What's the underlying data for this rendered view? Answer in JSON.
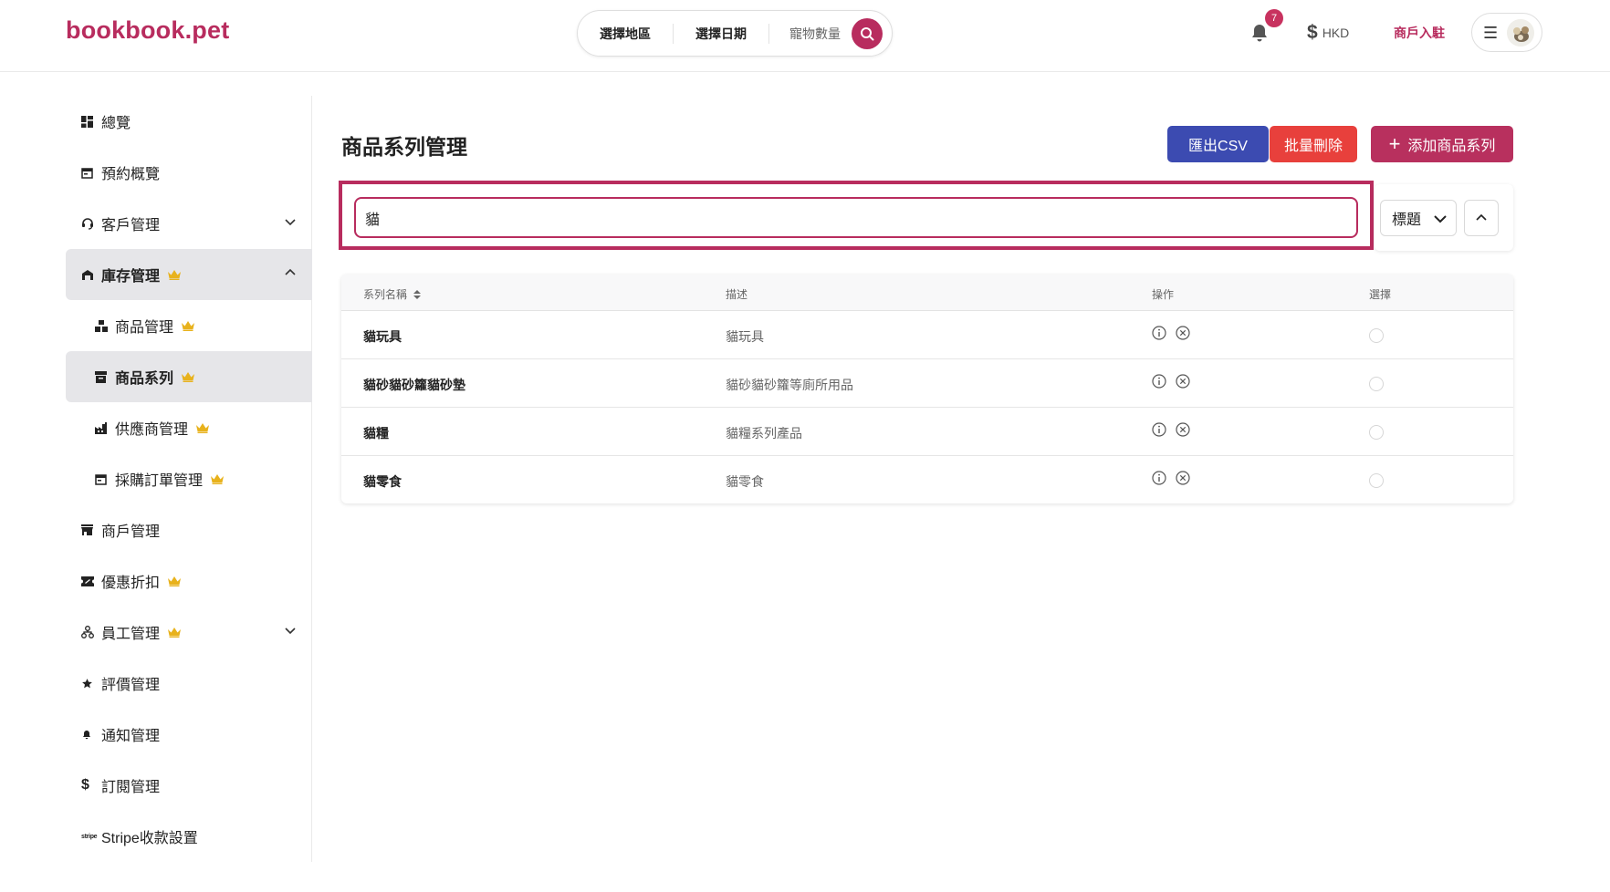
{
  "header": {
    "logo": "bookbook.pet",
    "search": {
      "region_label": "選擇地區",
      "date_label": "選擇日期",
      "pets_label": "寵物數量"
    },
    "notification_count": "7",
    "currency": "HKD",
    "merchant_link": "商戶入駐"
  },
  "sidebar": {
    "items": [
      {
        "label": "總覽",
        "icon": "dashboard-icon"
      },
      {
        "label": "預約概覽",
        "icon": "calendar-icon"
      },
      {
        "label": "客戶管理",
        "icon": "headset-icon",
        "expandable": true
      },
      {
        "label": "庫存管理",
        "icon": "warehouse-icon",
        "premium": true,
        "expanded": true
      },
      {
        "label": "商品管理",
        "icon": "boxes-icon",
        "premium": true
      },
      {
        "label": "商品系列",
        "icon": "archive-icon",
        "premium": true,
        "active": true
      },
      {
        "label": "供應商管理",
        "icon": "factory-icon",
        "premium": true
      },
      {
        "label": "採購訂單管理",
        "icon": "calendar-icon",
        "premium": true
      },
      {
        "label": "商戶管理",
        "icon": "store-icon"
      },
      {
        "label": "優惠折扣",
        "icon": "ticket-icon",
        "premium": true
      },
      {
        "label": "員工管理",
        "icon": "org-chart-icon",
        "premium": true,
        "expandable": true
      },
      {
        "label": "評價管理",
        "icon": "star-icon"
      },
      {
        "label": "通知管理",
        "icon": "bell-icon"
      },
      {
        "label": "訂閱管理",
        "icon": "dollar-icon"
      },
      {
        "label": "Stripe收款設置",
        "icon": "stripe-icon"
      }
    ]
  },
  "main": {
    "title": "商品系列管理",
    "buttons": {
      "export_csv": "匯出CSV",
      "bulk_delete": "批量刪除",
      "add_series": "添加商品系列"
    },
    "search_value": "貓",
    "sort_field": "標題",
    "table": {
      "headers": {
        "name": "系列名稱",
        "desc": "描述",
        "ops": "操作",
        "select": "選擇"
      },
      "rows": [
        {
          "name": "貓玩具",
          "desc": "貓玩具"
        },
        {
          "name": "貓砂貓砂籮貓砂墊",
          "desc": "貓砂貓砂籮等廁所用品"
        },
        {
          "name": "貓糧",
          "desc": "貓糧系列產品"
        },
        {
          "name": "貓零食",
          "desc": "貓零食"
        }
      ]
    }
  },
  "colors": {
    "brand": "#b82c5e",
    "export_button": "#3c4bb1",
    "delete_button": "#e8403c",
    "crown": "#e8b21c",
    "active_bg": "#e6e6e9"
  }
}
